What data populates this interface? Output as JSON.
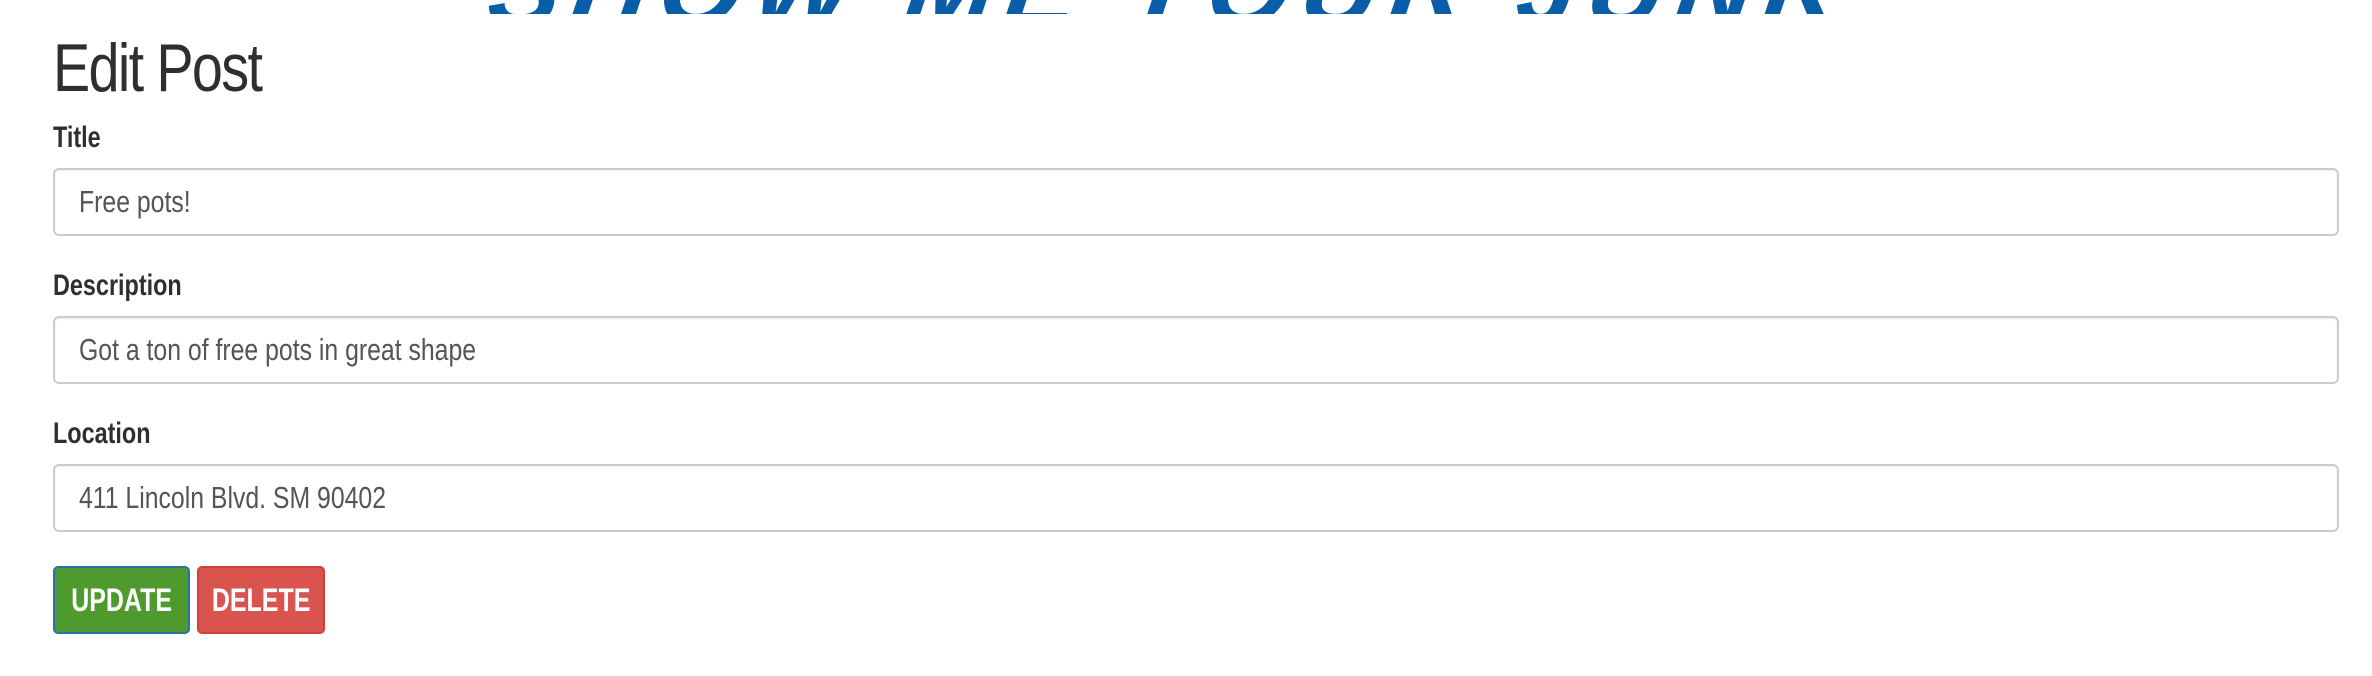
{
  "banner": {
    "logo_text": "SHOW ME YOUR JUNK"
  },
  "page": {
    "title": "Edit Post"
  },
  "form": {
    "title_label": "Title",
    "title_value": "Free pots!",
    "description_label": "Description",
    "description_value": "Got a ton of free pots in great shape",
    "location_label": "Location",
    "location_value": "411 Lincoln Blvd. SM 90402",
    "update_button": "UPDATE",
    "delete_button": "DELETE"
  },
  "colors": {
    "logo": "#0a5ea8",
    "update_button": "#4e9a2e",
    "delete_button": "#d9534f",
    "input_border": "#cccccc"
  }
}
